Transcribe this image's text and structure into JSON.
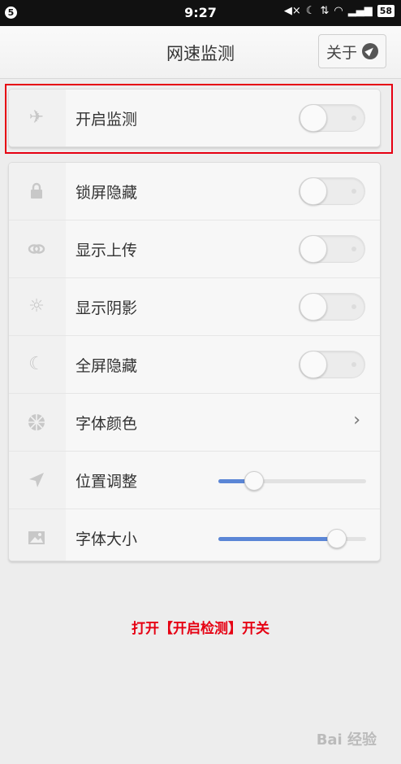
{
  "status_bar": {
    "left_badge": "5",
    "time": "9:27",
    "icons": [
      "mute-icon",
      "moon-icon",
      "signal-arrow-icon",
      "wifi-icon",
      "cell-signal-icon"
    ],
    "battery": "58"
  },
  "header": {
    "title": "网速监测",
    "about_label": "关于",
    "about_icon": "compass-icon"
  },
  "monitor_row": {
    "label": "开启监测",
    "icon": "airplane-icon",
    "toggle_on": false
  },
  "settings": [
    {
      "label": "锁屏隐藏",
      "icon": "lock-icon",
      "control": "toggle",
      "on": false
    },
    {
      "label": "显示上传",
      "icon": "link-icon",
      "control": "toggle",
      "on": false
    },
    {
      "label": "显示阴影",
      "icon": "sun-icon",
      "control": "toggle",
      "on": false
    },
    {
      "label": "全屏隐藏",
      "icon": "moon-icon",
      "control": "toggle",
      "on": false
    },
    {
      "label": "字体颜色",
      "icon": "aperture-icon",
      "control": "chevron"
    },
    {
      "label": "位置调整",
      "icon": "location-arrow-icon",
      "control": "slider",
      "value_fraction": 0.24
    },
    {
      "label": "字体大小",
      "icon": "image-icon",
      "control": "slider",
      "value_fraction": 0.8
    }
  ],
  "caption": "打开【开启检测】开关",
  "watermark": "Bai 经验",
  "colors": {
    "highlight": "#e60012",
    "slider_fill": "#5b86d6",
    "caption": "#e60012"
  }
}
